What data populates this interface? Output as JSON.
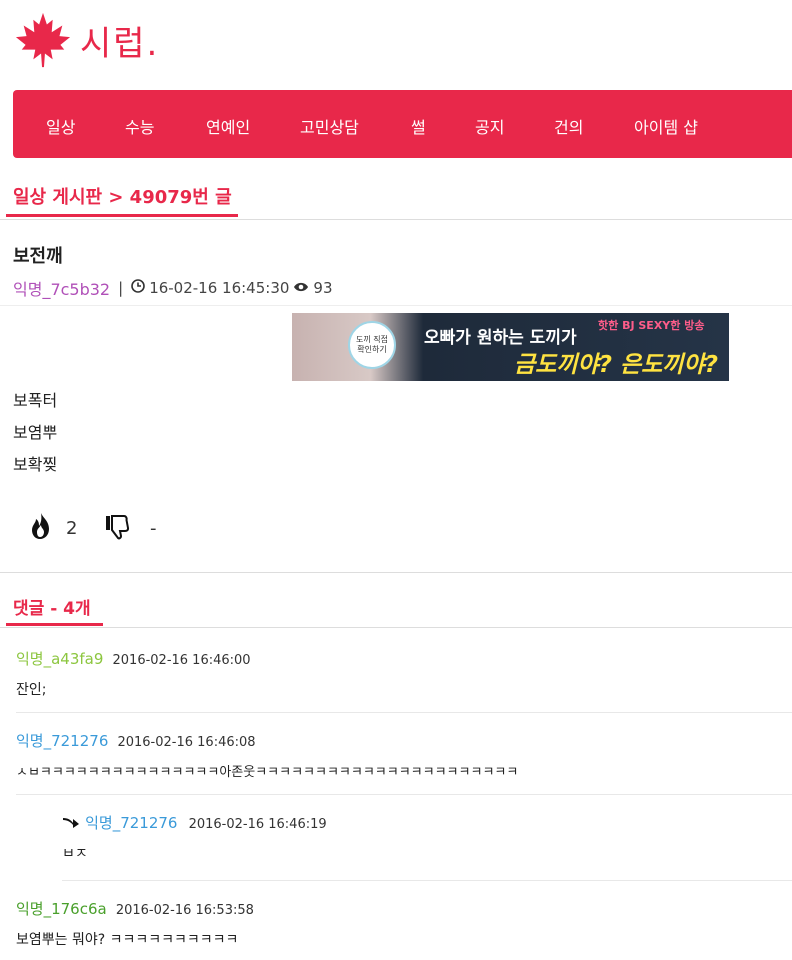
{
  "site": {
    "name": "시럽.",
    "brand_color": "#e8284a"
  },
  "nav": {
    "items": [
      "일상",
      "수능",
      "연예인",
      "고민상담",
      "썰",
      "공지",
      "건의",
      "아이템 샵"
    ]
  },
  "board": {
    "title": "일상 게시판 > 49079번 글"
  },
  "post": {
    "title": "보전깨",
    "author": "익명_7c5b32",
    "separator": "|",
    "time": "16-02-16 16:45:30",
    "views": "93",
    "lines": [
      "보폭터",
      "보염뿌",
      "보확찢"
    ],
    "likes": "2",
    "dislikes": "-"
  },
  "ad": {
    "circle_line1": "도끼 직접",
    "circle_line2": "확인하기",
    "headline": "오빠가 원하는 도끼가",
    "tagline": "금도끼야? 은도끼야?",
    "corner": "핫한 BJ SEXY한 방송"
  },
  "comments": {
    "title": "댓글 - 4개",
    "items": [
      {
        "author": "익명_a43fa9",
        "author_color": "#8cc63f",
        "time": "2016-02-16 16:46:00",
        "text": "잔인;"
      },
      {
        "author": "익명_721276",
        "author_color": "#3a9ad9",
        "time": "2016-02-16 16:46:08",
        "text": "ㅅㅂㅋㅋㅋㅋㅋㅋㅋㅋㅋㅋㅋㅋㅋㅋㅋ아존웃ㅋㅋㅋㅋㅋㅋㅋㅋㅋㅋㅋㅋㅋㅋㅋㅋㅋㅋㅋㅋㅋㅋ"
      },
      {
        "author": "익명_721276",
        "author_color": "#3a9ad9",
        "time": "2016-02-16 16:46:19",
        "text": "ㅂㅈ",
        "reply": true
      },
      {
        "author": "익명_176c6a",
        "author_color": "#4aa02c",
        "time": "2016-02-16 16:53:58",
        "text": "보염뿌는 뭐야? ㅋㅋㅋㅋㅋㅋㅋㅋㅋㅋ"
      }
    ]
  }
}
